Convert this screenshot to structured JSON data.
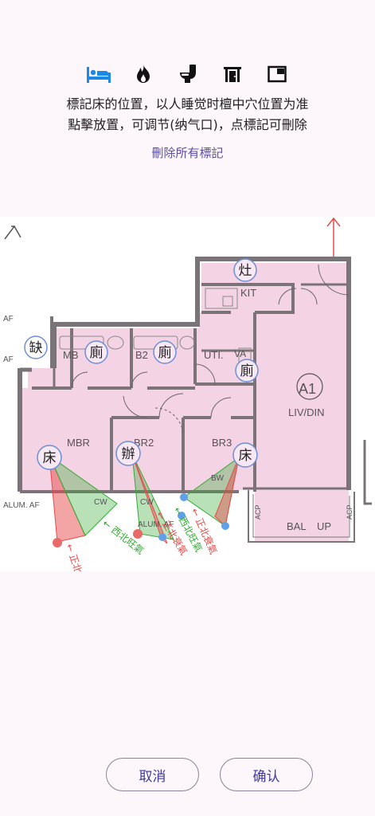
{
  "toolbar": {
    "items": [
      {
        "icon": "bed-icon",
        "active": true
      },
      {
        "icon": "fire-icon",
        "active": false
      },
      {
        "icon": "toilet-icon",
        "active": false
      },
      {
        "icon": "door-icon",
        "active": false
      },
      {
        "icon": "window-icon",
        "active": false
      }
    ],
    "active_color": "#1e88e5",
    "inactive_color": "#111111"
  },
  "instructions": {
    "line1": "標記床的位置，以人睡觉时檀中穴位置为准",
    "line2": "點擊放置，可调节(纳气口)，点標記可刪除"
  },
  "delete_all_label": "刪除所有標記",
  "floorplan": {
    "rooms": {
      "kit": "KIT",
      "mb": "MB",
      "b2": "B2",
      "uti": "UTI.",
      "va": "VA",
      "liv_din": "LIV/DIN",
      "unit": "A1",
      "mbr": "MBR",
      "br2": "BR2",
      "br3": "BR3",
      "bal": "BAL",
      "up": "UP",
      "acp_left": "ACP",
      "acp_right": "ACP"
    },
    "labels": {
      "af1": "AF",
      "af2": "AF",
      "alum_af_left": "ALUM. AF",
      "alum_af_mid": "ALUM. AF",
      "cw1": "CW",
      "cw2": "CW",
      "bw": "BW"
    },
    "markers": [
      {
        "name": "stove-marker",
        "text": "灶"
      },
      {
        "name": "missing-corner-marker",
        "text": "缺"
      },
      {
        "name": "toilet-marker-1",
        "text": "廁"
      },
      {
        "name": "toilet-marker-2",
        "text": "廁"
      },
      {
        "name": "toilet-marker-3",
        "text": "廁"
      },
      {
        "name": "bed-marker-1",
        "text": "床"
      },
      {
        "name": "office-marker",
        "text": "辦"
      },
      {
        "name": "bed-marker-2",
        "text": "床"
      }
    ],
    "annotations": {
      "a1": "← 正北衰氣",
      "a2": "← 西北旺氣",
      "a3": "← 正北衰氣",
      "a4": "← 西北旺氣",
      "a5": "← 正北衰氣"
    },
    "colors": {
      "room_fill": "#f4d3e4",
      "wall": "#7a7478",
      "good_qi": "#33aa33",
      "bad_qi": "#e84a4a",
      "marker_border": "#6c8fd6",
      "north_arrow": "#e74c4c"
    }
  },
  "buttons": {
    "cancel": "取消",
    "confirm": "确认"
  }
}
